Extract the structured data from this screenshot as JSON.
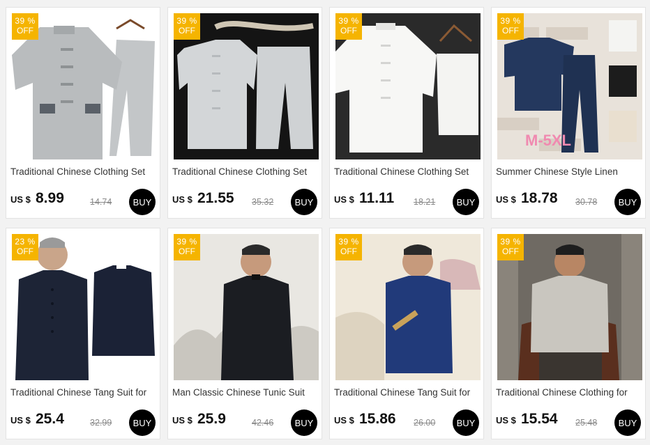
{
  "colors": {
    "badge": "#f5b400",
    "buy": "#000000",
    "background": "#f2f2f2"
  },
  "products": [
    {
      "discount": "39 %",
      "off": "OFF",
      "title": "Traditional Chinese Clothing Set",
      "currency": "US $",
      "price": "8.99",
      "original_price": "14.74",
      "buy": "BUY"
    },
    {
      "discount": "39 %",
      "off": "OFF",
      "title": "Traditional Chinese Clothing Set",
      "currency": "US $",
      "price": "21.55",
      "original_price": "35.32",
      "buy": "BUY"
    },
    {
      "discount": "39 %",
      "off": "OFF",
      "title": "Traditional Chinese Clothing Set",
      "currency": "US $",
      "price": "11.11",
      "original_price": "18.21",
      "buy": "BUY"
    },
    {
      "discount": "39 %",
      "off": "OFF",
      "title": "Summer Chinese Style Linen",
      "currency": "US $",
      "price": "18.78",
      "original_price": "30.78",
      "buy": "BUY",
      "image_text": "M-5XL"
    },
    {
      "discount": "23 %",
      "off": "OFF",
      "title": "Traditional Chinese Tang Suit for",
      "currency": "US $",
      "price": "25.4",
      "original_price": "32.99",
      "buy": "BUY"
    },
    {
      "discount": "39 %",
      "off": "OFF",
      "title": "Man Classic Chinese Tunic Suit",
      "currency": "US $",
      "price": "25.9",
      "original_price": "42.46",
      "buy": "BUY"
    },
    {
      "discount": "39 %",
      "off": "OFF",
      "title": "Traditional Chinese Tang Suit for",
      "currency": "US $",
      "price": "15.86",
      "original_price": "26.00",
      "buy": "BUY"
    },
    {
      "discount": "39 %",
      "off": "OFF",
      "title": "Traditional Chinese Clothing for",
      "currency": "US $",
      "price": "15.54",
      "original_price": "25.48",
      "buy": "BUY"
    }
  ]
}
